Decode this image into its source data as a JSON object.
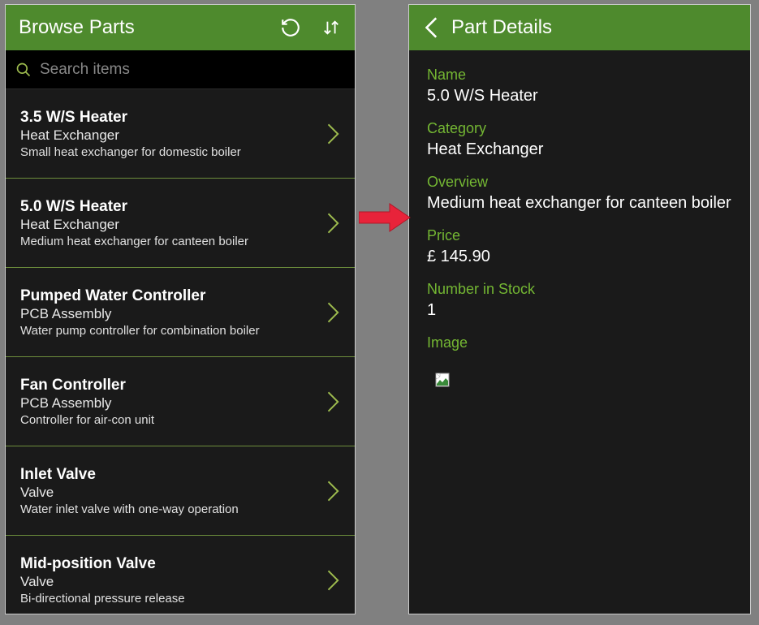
{
  "browse": {
    "title": "Browse Parts",
    "search_placeholder": "Search items",
    "items": [
      {
        "title": "3.5 W/S Heater",
        "category": "Heat Exchanger",
        "desc": "Small heat exchanger for domestic boiler"
      },
      {
        "title": "5.0 W/S Heater",
        "category": "Heat Exchanger",
        "desc": "Medium  heat exchanger for canteen boiler"
      },
      {
        "title": "Pumped Water Controller",
        "category": "PCB Assembly",
        "desc": "Water pump controller for combination boiler"
      },
      {
        "title": "Fan Controller",
        "category": "PCB Assembly",
        "desc": "Controller for air-con unit"
      },
      {
        "title": "Inlet Valve",
        "category": "Valve",
        "desc": "Water inlet valve with one-way operation"
      },
      {
        "title": "Mid-position Valve",
        "category": "Valve",
        "desc": "Bi-directional pressure release"
      }
    ]
  },
  "details": {
    "title": "Part Details",
    "labels": {
      "name": "Name",
      "category": "Category",
      "overview": "Overview",
      "price": "Price",
      "stock": "Number in Stock",
      "image": "Image"
    },
    "name": "5.0 W/S Heater",
    "category": "Heat Exchanger",
    "overview": "Medium  heat exchanger for canteen boiler",
    "price": "£ 145.90",
    "stock": "1"
  }
}
